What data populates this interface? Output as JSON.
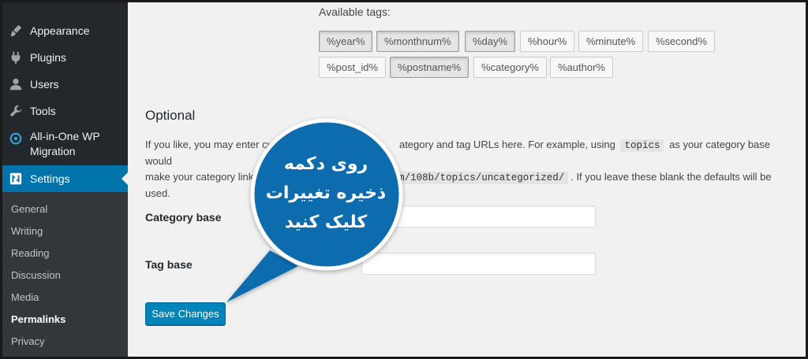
{
  "sidebar": {
    "menu": [
      {
        "label": "Appearance",
        "icon": "paintbrush-icon"
      },
      {
        "label": "Plugins",
        "icon": "plug-icon"
      },
      {
        "label": "Users",
        "icon": "users-icon"
      },
      {
        "label": "Tools",
        "icon": "wrench-icon"
      },
      {
        "label": "All-in-One WP Migration",
        "line1": "All-in-One WP",
        "line2": "Migration",
        "icon": "migration-icon"
      },
      {
        "label": "Settings",
        "icon": "settings-icon",
        "active": true
      }
    ],
    "submenu": [
      "General",
      "Writing",
      "Reading",
      "Discussion",
      "Media",
      "Permalinks",
      "Privacy"
    ],
    "current_submenu": "Permalinks"
  },
  "tags": {
    "label": "Available tags:",
    "row1": [
      "%year%",
      "%monthnum%",
      "%day%",
      "%hour%",
      "%minute%",
      "%second%"
    ],
    "row2": [
      "%post_id%",
      "%postname%",
      "%category%",
      "%author%"
    ],
    "pressed": [
      "%year%",
      "%monthnum%",
      "%day%",
      "%postname%"
    ]
  },
  "optional": {
    "heading": "Optional",
    "desc_part1": "If you like, you may enter cust",
    "desc_part2": "ategory and tag URLs here. For example, using",
    "code_topics": "topics",
    "desc_part3": "as your category base would",
    "desc_line2a": "make your category links lik",
    "code_url": "om/108b/topics/uncategorized/",
    "desc_line2b": ". If you leave these blank the defaults will be",
    "desc_line3": "used."
  },
  "fields": {
    "category_base_label": "Category base",
    "category_base_value": "",
    "tag_base_label": "Tag base",
    "tag_base_value": ""
  },
  "save_button": "Save Changes",
  "annotation": {
    "line1": "روی دکمه",
    "line2": "ذخیره تغییرات",
    "line3": "کلیک کنید"
  },
  "colors": {
    "sidebar_bg": "#23282d",
    "submenu_bg": "#32373c",
    "accent": "#0073aa",
    "button": "#0085ba",
    "callout": "#0f6cad"
  }
}
